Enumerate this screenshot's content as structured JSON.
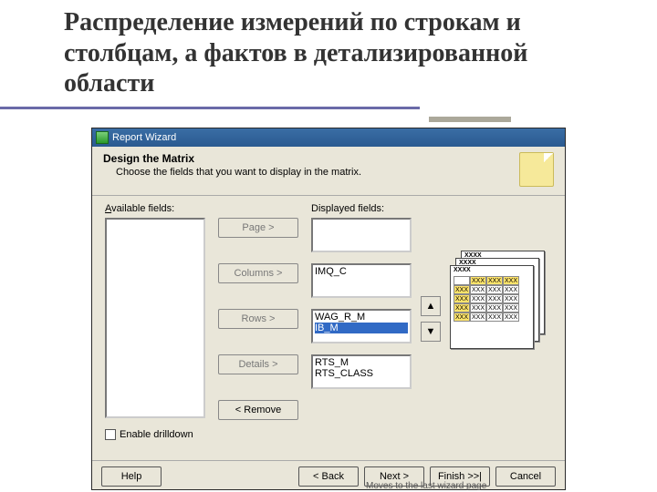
{
  "slide": {
    "title": "Распределение измерений по строкам и столбцам, а фактов в детализированной области"
  },
  "wizard": {
    "title": "Report Wizard",
    "head_title": "Design the Matrix",
    "head_sub": "Choose the fields that you want to display in the matrix.",
    "available_label": "Available fields:",
    "displayed_label": "Displayed fields:",
    "buttons": {
      "page": "Page >",
      "columns": "Columns >",
      "rows": "Rows >",
      "details": "Details >",
      "remove": "< Remove"
    },
    "columns_box": {
      "i0": "IMQ_C"
    },
    "rows_box": {
      "i0": "WAG_R_M",
      "i1": "IB_M"
    },
    "details_box": {
      "i0": "RTS_M",
      "i1": "RTS_CLASS"
    },
    "arrow_up": "▲",
    "arrow_down": "▼",
    "drilldown_label": "Enable drilldown",
    "preview": {
      "hdr": "XXXX",
      "col": "XXX",
      "row": "XXX"
    },
    "footer": {
      "help": "Help",
      "back": "< Back",
      "next": "Next >",
      "finish": "Finish >>|",
      "cancel": "Cancel"
    },
    "status": "Moves to the last wizard page"
  }
}
